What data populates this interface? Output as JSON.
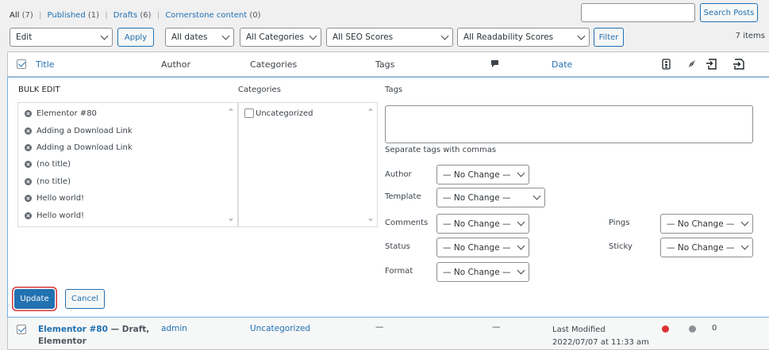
{
  "filters": {
    "all_label": "All",
    "all_count": "(7)",
    "published_label": "Published",
    "published_count": "(1)",
    "drafts_label": "Drafts",
    "drafts_count": "(6)",
    "cornerstone_label": "Cornerstone content",
    "cornerstone_count": "(0)",
    "separator": "|"
  },
  "search": {
    "value": "",
    "button_label": "Search Posts"
  },
  "toolbar": {
    "bulk_action_value": "Edit",
    "apply_label": "Apply",
    "dates_value": "All dates",
    "categories_value": "All Categories",
    "seo_value": "All SEO Scores",
    "readability_value": "All Readability Scores",
    "filter_label": "Filter",
    "items_count": "7 items"
  },
  "table_header": {
    "title": "Title",
    "author": "Author",
    "categories": "Categories",
    "tags": "Tags",
    "date": "Date"
  },
  "bulk_edit": {
    "heading": "BULK EDIT",
    "titles": [
      "Elementor #80",
      "Adding a Download Link",
      "Adding a Download Link",
      "(no title)",
      "(no title)",
      "Hello world!",
      "Hello world!"
    ],
    "categories_label": "Categories",
    "categories": [
      "Uncategorized"
    ],
    "tags_label": "Tags",
    "tags_value": "",
    "tags_hint": "Separate tags with commas",
    "author_label": "Author",
    "author_value": "— No Change —",
    "template_label": "Template",
    "template_value": "— No Change —",
    "comments_label": "Comments",
    "comments_value": "— No Change —",
    "status_label": "Status",
    "status_value": "— No Change —",
    "format_label": "Format",
    "format_value": "— No Change —",
    "pings_label": "Pings",
    "pings_value": "— No Change —",
    "sticky_label": "Sticky",
    "sticky_value": "— No Change —",
    "update_label": "Update",
    "cancel_label": "Cancel"
  },
  "row": {
    "title_line1": "Elementor #80",
    "state": " — Draft,",
    "title_line2": "Elementor",
    "author": "admin",
    "category": "Uncategorized",
    "tags": "—",
    "comments": "—",
    "date_label": "Last Modified",
    "date_value": "2022/07/07 at 11:33 am",
    "seo_color": "#dc3232",
    "readability_color": "#8c8f94",
    "links_count": "0"
  }
}
